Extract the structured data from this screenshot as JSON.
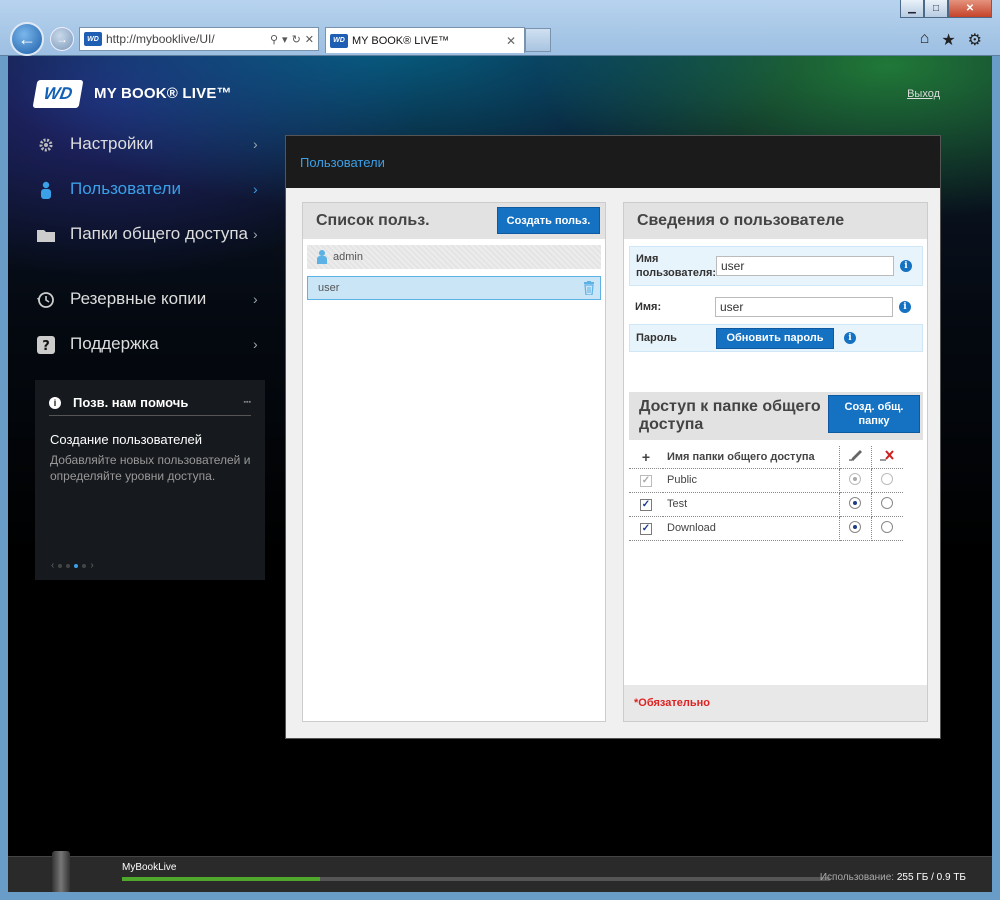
{
  "browser": {
    "url": "http://mybooklive/UI/",
    "tab_title": "MY BOOK® LIVE™",
    "favicon_text": "WD"
  },
  "header": {
    "logo_text": "WD",
    "product_name": "MY BOOK® LIVE™",
    "logout_label": "Выход"
  },
  "nav": {
    "items": [
      {
        "label": "Настройки",
        "icon": "gear-icon",
        "active": false
      },
      {
        "label": "Пользователи",
        "icon": "user-icon",
        "active": true
      },
      {
        "label": "Папки общего доступа",
        "icon": "folder-icon",
        "active": false
      },
      {
        "label": "Резервные копии",
        "icon": "history-icon",
        "active": false
      },
      {
        "label": "Поддержка",
        "icon": "question-icon",
        "active": false
      }
    ]
  },
  "help": {
    "title": "Позв. нам помочь",
    "heading": "Создание пользователей",
    "body": "Добавляйте новых пользователей и определяйте уровни доступа.",
    "pages": 4,
    "current_page": 3
  },
  "main": {
    "title": "Пользователи"
  },
  "users_panel": {
    "title": "Список польз.",
    "create_label": "Создать польз.",
    "users": [
      {
        "name": "admin",
        "selected": false
      },
      {
        "name": "user",
        "selected": true
      }
    ]
  },
  "details": {
    "title": "Сведения о пользователе",
    "username_label": "Имя пользователя:",
    "username_required_mark": "*",
    "username_value": "user",
    "name_label": "Имя:",
    "name_value": "user",
    "password_label": "Пароль",
    "update_password_label": "Обновить пароль",
    "info_glyph": "i"
  },
  "share_access": {
    "title": "Доступ к папке общего доступа",
    "create_share_label": "Созд. общ. папку",
    "add_glyph": "+",
    "column_name": "Имя папки общего доступа",
    "shares": [
      {
        "name": "Public",
        "checked": true,
        "disabled": true,
        "access": "rw"
      },
      {
        "name": "Test",
        "checked": true,
        "disabled": false,
        "access": "rw"
      },
      {
        "name": "Download",
        "checked": true,
        "disabled": false,
        "access": "rw"
      }
    ]
  },
  "required_note": "*Обязательно",
  "status": {
    "device_name": "MyBookLive",
    "usage_prefix": "Использование:",
    "usage_value": "255 ГБ / 0.9 ТБ",
    "usage_fraction": 0.28
  }
}
